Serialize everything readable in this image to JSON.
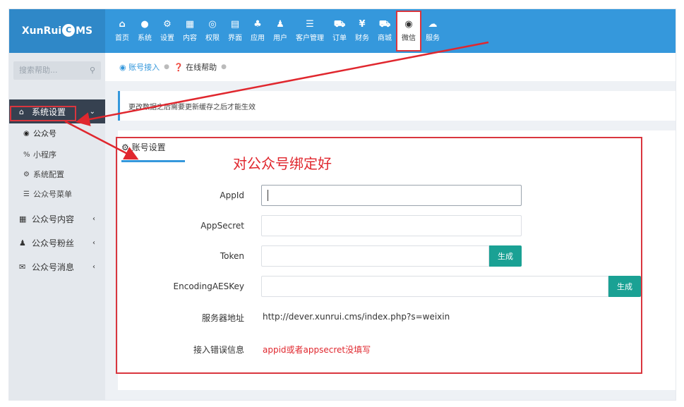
{
  "logo": {
    "part1": "XunRui",
    "part2": "C",
    "part3": "MS"
  },
  "nav": [
    {
      "icon": "home-icon",
      "glyph": "⌂",
      "label": "首页"
    },
    {
      "icon": "globe-icon",
      "glyph": "●",
      "label": "系统"
    },
    {
      "icon": "gears-icon",
      "glyph": "⚙",
      "label": "设置"
    },
    {
      "icon": "grid-icon",
      "glyph": "▦",
      "label": "内容"
    },
    {
      "icon": "user-shield-icon",
      "glyph": "◎",
      "label": "权限"
    },
    {
      "icon": "layout-icon",
      "glyph": "▤",
      "label": "界面"
    },
    {
      "icon": "plugin-icon",
      "glyph": "♣",
      "label": "应用"
    },
    {
      "icon": "user-icon",
      "glyph": "♟",
      "label": "用户"
    },
    {
      "icon": "list-icon",
      "glyph": "☰",
      "label": "客户管理"
    },
    {
      "icon": "cart-icon",
      "glyph": "⛟",
      "label": "订单"
    },
    {
      "icon": "yen-icon",
      "glyph": "¥",
      "label": "财务"
    },
    {
      "icon": "store-icon",
      "glyph": "⛟",
      "label": "商城"
    },
    {
      "icon": "wechat-icon",
      "glyph": "◉",
      "label": "微信"
    },
    {
      "icon": "cloud-icon",
      "glyph": "☁",
      "label": "服务"
    }
  ],
  "sidebar": {
    "search_placeholder": "搜索帮助...",
    "groups": [
      {
        "label": "系统设置",
        "icon": "home-icon",
        "glyph": "⌂",
        "chevron": "⌄"
      },
      {
        "label": "公众号内容",
        "icon": "grid-icon",
        "glyph": "▦",
        "chevron": "‹"
      },
      {
        "label": "公众号粉丝",
        "icon": "user-icon",
        "glyph": "♟",
        "chevron": "‹"
      },
      {
        "label": "公众号消息",
        "icon": "envelope-icon",
        "glyph": "✉",
        "chevron": "‹"
      }
    ],
    "subitems": [
      {
        "label": "公众号",
        "icon": "wechat-icon",
        "glyph": "◉"
      },
      {
        "label": "小程序",
        "icon": "link-icon",
        "glyph": "%"
      },
      {
        "label": "系统配置",
        "icon": "gear-icon",
        "glyph": "⚙"
      },
      {
        "label": "公众号菜单",
        "icon": "list-icon",
        "glyph": "☰"
      }
    ]
  },
  "breadcrumb": {
    "item1": "账号接入",
    "item2": "在线帮助"
  },
  "notice": "更改数据之后需要更新缓存之后才能生效",
  "panel": {
    "tab": "账号设置",
    "annotation": "对公众号绑定好",
    "fields": {
      "appid_label": "AppId",
      "appsecret_label": "AppSecret",
      "token_label": "Token",
      "aes_label": "EncodingAESKey",
      "server_label": "服务器地址",
      "server_value": "http://dever.xunrui.cms/index.php?s=weixin",
      "error_label": "接入错误信息",
      "error_value": "appid或者appsecret没填写"
    },
    "generate_label": "生成"
  }
}
